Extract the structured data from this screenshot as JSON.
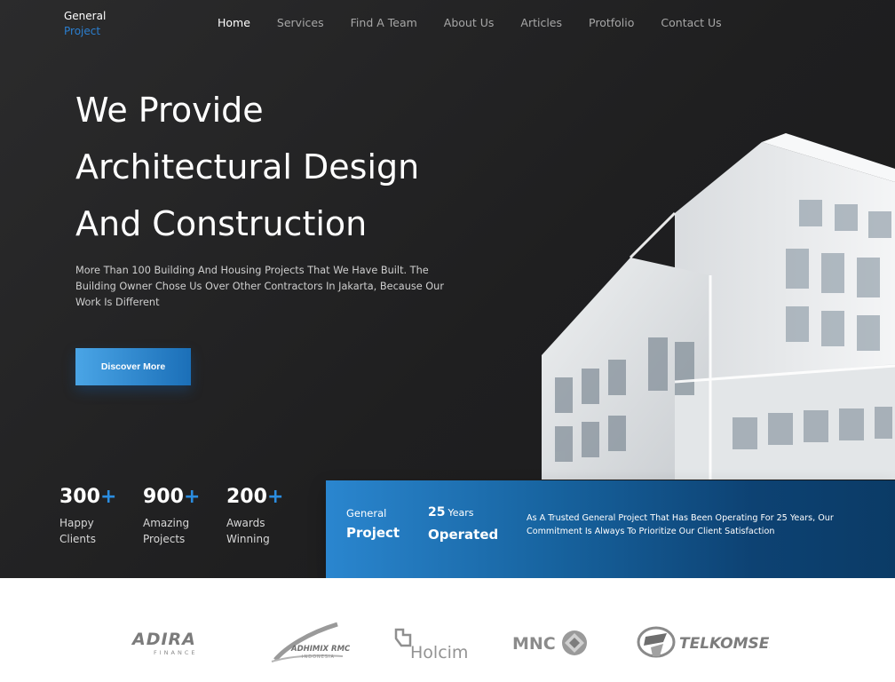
{
  "brand": {
    "line1": "General",
    "line2": "Project"
  },
  "nav": [
    {
      "label": "Home",
      "active": true
    },
    {
      "label": "Services"
    },
    {
      "label": "Find A Team"
    },
    {
      "label": "About Us"
    },
    {
      "label": "Articles"
    },
    {
      "label": "Protfolio"
    },
    {
      "label": "Contact Us"
    }
  ],
  "hero": {
    "headline": [
      "We Provide",
      "Architectural Design",
      "And Construction"
    ],
    "subtitle": "More Than 100 Building And Housing Projects That We Have Built. The Building Owner Chose Us Over Other Contractors In Jakarta, Because Our Work Is Different",
    "cta_label": "Discover More"
  },
  "stats": [
    {
      "number": "300",
      "suffix": "+",
      "label": "Happy\nClients"
    },
    {
      "number": "900",
      "suffix": "+",
      "label": "Amazing\nProjects"
    },
    {
      "number": "200",
      "suffix": "+",
      "label": "Awards\nWinning"
    }
  ],
  "info": {
    "col1_a": "General",
    "col1_b": "Project",
    "col2_num": "25",
    "col2_unit": "Years",
    "col2_b": "Operated",
    "text": "As A Trusted General Project That Has Been Operating For 25 Years, Our Commitment Is Always To Prioritize Our Client Satisfaction"
  },
  "partners": {
    "adira": "ADIRA",
    "adira_sub": "FINANCE",
    "adhimix": "ADHIMIX RMC",
    "adhimix_sub": "INDONESIA",
    "holcim": "Holcim",
    "mnc": "MNC",
    "telkomsel": "TELKOMSEL"
  },
  "colors": {
    "accent": "#2b8de0",
    "dark_bg": "#252526",
    "info_start": "#2a86cf",
    "info_end": "#0b3b66"
  }
}
